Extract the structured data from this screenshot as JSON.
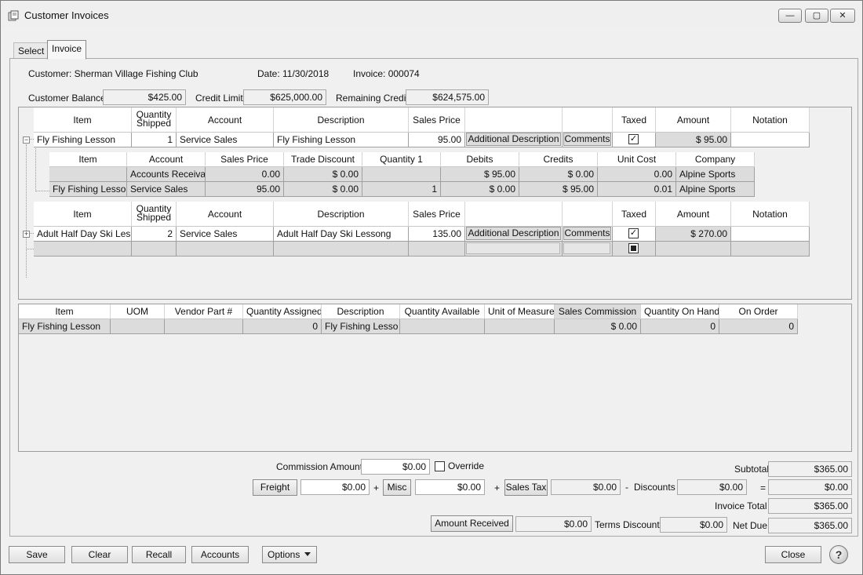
{
  "window": {
    "title": "Customer Invoices",
    "minimize": "—",
    "maximize": "▢",
    "close": "✕"
  },
  "tabs": [
    {
      "label": "Select"
    },
    {
      "label": "Invoice"
    }
  ],
  "header": {
    "customer": "Customer: Sherman Village Fishing Club",
    "date": "Date: 11/30/2018",
    "invoice": "Invoice: 000074",
    "customer_balance_label": "Customer Balance",
    "customer_balance": "$425.00",
    "credit_limit_label": "Credit Limit",
    "credit_limit": "$625,000.00",
    "remaining_credit_label": "Remaining Credit",
    "remaining_credit": "$624,575.00"
  },
  "line_columns": {
    "item": "Item",
    "qty_line1": "Quantity",
    "qty_line2": "Shipped",
    "account": "Account",
    "description": "Description",
    "sales_price": "Sales Price",
    "taxed": "Taxed",
    "amount": "Amount",
    "notation": "Notation",
    "add_desc_button": "Additional Description",
    "comments_button": "Comments"
  },
  "lines": [
    {
      "item": "Fly Fishing Lesson",
      "qty": "1",
      "account": "Service Sales",
      "description": "Fly Fishing Lesson",
      "sales_price": "95.00",
      "amount": "$ 95.00",
      "notation": ""
    },
    {
      "item": "Adult Half Day Ski Les",
      "qty": "2",
      "account": "Service Sales",
      "description": "Adult Half Day Ski Lessong",
      "sales_price": "135.00",
      "amount": "$ 270.00",
      "notation": ""
    }
  ],
  "gl_columns": [
    "Item",
    "Account",
    "Sales Price",
    "Trade Discount",
    "Quantity 1",
    "Debits",
    "Credits",
    "Unit Cost",
    "Company"
  ],
  "gl_rows": [
    [
      "",
      "Accounts Receiva",
      "0.00",
      "$ 0.00",
      "",
      "$ 95.00",
      "$ 0.00",
      "0.00",
      "Alpine Sports"
    ],
    [
      "Fly Fishing Lesso",
      "Service Sales",
      "95.00",
      "$ 0.00",
      "1",
      "$ 0.00",
      "$ 95.00",
      "0.01",
      "Alpine Sports"
    ]
  ],
  "lower_columns": [
    "Item",
    "UOM",
    "Vendor Part #",
    "Quantity Assigned",
    "Description",
    "Quantity Available",
    "Unit of Measure",
    "Sales Commission",
    "Quantity On Hand",
    "On Order"
  ],
  "lower_rows": [
    [
      "Fly Fishing Lesson",
      "",
      "",
      "0",
      "Fly Fishing Lesso",
      "",
      "",
      "$ 0.00",
      "0",
      "0"
    ]
  ],
  "totals": {
    "commission_label": "Commission Amount",
    "commission": "$0.00",
    "override_label": "Override",
    "freight_label": "Freight",
    "freight": "$0.00",
    "plus1": "+",
    "misc_label": "Misc",
    "misc": "$0.00",
    "plus2": "+",
    "sales_tax_label": "Sales Tax",
    "sales_tax": "$0.00",
    "minus": "-",
    "discounts_label": "Discounts",
    "discounts": "$0.00",
    "equals": "=",
    "discounts_result": "$0.00",
    "subtotal_label": "Subtotal",
    "subtotal": "$365.00",
    "invoice_total_label": "Invoice Total",
    "invoice_total": "$365.00",
    "amount_received_label": "Amount Received",
    "amount_received": "$0.00",
    "terms_discount_label": "Terms Discount",
    "terms_discount": "$0.00",
    "net_due_label": "Net Due",
    "net_due": "$365.00"
  },
  "footer": {
    "save": "Save",
    "clear": "Clear",
    "recall": "Recall",
    "accounts": "Accounts",
    "options": "Options",
    "close": "Close",
    "help": "?"
  }
}
